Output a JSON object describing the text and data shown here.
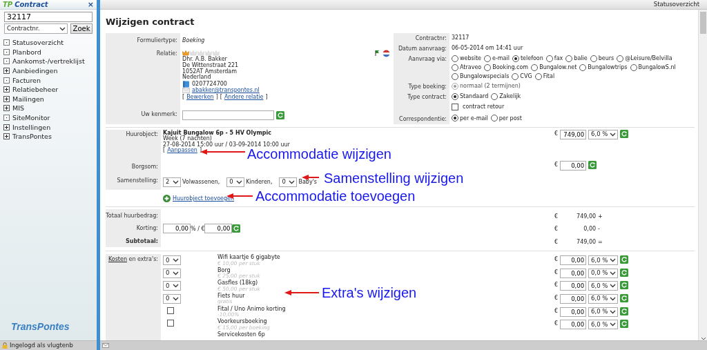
{
  "sidebar": {
    "title_prefix": "TP",
    "title": "Contract",
    "close": "×",
    "search_value": "32117",
    "search_type": "Contractnr.",
    "search_button": "Zoek",
    "items": [
      {
        "label": "Statusoverzicht",
        "kind": "leaf"
      },
      {
        "label": "Planbord",
        "kind": "leaf"
      },
      {
        "label": "Aankomst-/vertreklijst",
        "kind": "leaf"
      },
      {
        "label": "Aanbiedingen",
        "kind": "group",
        "expanded": false
      },
      {
        "label": "Facturen",
        "kind": "leaf"
      },
      {
        "label": "Relatiebeheer",
        "kind": "group",
        "expanded": false
      },
      {
        "label": "Mailingen",
        "kind": "group",
        "expanded": false
      },
      {
        "label": "MIS",
        "kind": "group",
        "expanded": false
      },
      {
        "label": "SiteMonitor",
        "kind": "leaf"
      },
      {
        "label": "Instellingen",
        "kind": "group",
        "expanded": false
      },
      {
        "label": "TransPontes",
        "kind": "group",
        "expanded": false
      }
    ],
    "logo": "TransPontes",
    "login": "Ingelogd als vlugtenb"
  },
  "topbar": {
    "link": "Statusoverzicht"
  },
  "page_title": "Wijzigen contract",
  "relation_card": {
    "formuliertype": {
      "label": "Formuliertype:",
      "value": "Boeking"
    },
    "relatie": {
      "label": "Relatie:",
      "stars": 1,
      "lines": [
        "Dhr. A.B. Bakker",
        "De Wittenstraat 221",
        "1052AT Amsterdam",
        "Nederland"
      ],
      "phone": "0207724700",
      "email": "abakker@transpontes.nl",
      "bracket_open": "[",
      "bracket_close": "]",
      "links": [
        "Bewerken",
        "Andere relatie"
      ]
    },
    "kenmerk": {
      "label": "Uw kenmerk:"
    }
  },
  "contract_card": {
    "rows": [
      {
        "label": "Contractnr:",
        "kind": "text",
        "value": "32117"
      },
      {
        "label": "Datum aanvraag:",
        "kind": "text",
        "value": "06-05-2014 om 14:41 uur"
      },
      {
        "label": "Aanvraag via:",
        "kind": "radios",
        "disabled": false,
        "options": [
          {
            "label": "website",
            "selected": false
          },
          {
            "label": "e-mail",
            "selected": false
          },
          {
            "label": "telefoon",
            "selected": true
          },
          {
            "label": "fax",
            "selected": false
          },
          {
            "label": "balie",
            "selected": false
          },
          {
            "label": "beurs",
            "selected": false
          },
          {
            "label": "@Leisure/Belvilla",
            "selected": false
          },
          {
            "label": "Atraveo",
            "selected": false
          },
          {
            "label": "Booking.com",
            "selected": false
          },
          {
            "label": "Bungalow.net",
            "selected": false
          },
          {
            "label": "Bungalowtrips",
            "selected": false
          },
          {
            "label": "BungalowS.nl",
            "selected": false
          },
          {
            "label": "Bungalowspecials",
            "selected": false
          },
          {
            "label": "CVG",
            "selected": false
          },
          {
            "label": "Fital",
            "selected": false
          }
        ]
      },
      {
        "label": "Type boeking:",
        "kind": "radios",
        "disabled": true,
        "options": [
          {
            "label": "normaal (2 termijnen)",
            "selected": true
          }
        ]
      },
      {
        "label": "Type contract:",
        "kind": "radios",
        "disabled": false,
        "options": [
          {
            "label": "Standaard",
            "selected": true
          },
          {
            "label": "Zakelijk",
            "selected": false
          }
        ]
      },
      {
        "label": "",
        "kind": "checkbox",
        "option": {
          "label": "contract retour",
          "checked": false
        }
      },
      {
        "label": "Correspondentie:",
        "kind": "radios",
        "disabled": false,
        "options": [
          {
            "label": "per e-mail",
            "selected": true
          },
          {
            "label": "per post",
            "selected": false
          }
        ]
      }
    ]
  },
  "rental": {
    "huurobject": {
      "label": "Huurobject:",
      "name": "Kajuit Bungalow 6p - 5 HV Olympic",
      "period": "Week (7 nachten)",
      "dates": "27-08-2014 15:00 uur / 03-09-2014 10:00 uur",
      "bracket_open": "[",
      "bracket_close": "]",
      "link": "Aanpassen",
      "currency": "€",
      "amount": "749,00",
      "vat": "6,0 %"
    },
    "borgsom": {
      "label": "Borgsom:",
      "currency": "€",
      "amount": "0,00"
    },
    "samenstelling": {
      "label": "Samenstelling:",
      "parts": [
        {
          "value": "2",
          "unit": "Volwassenen,"
        },
        {
          "value": "0",
          "unit": "Kinderen,"
        },
        {
          "value": "0",
          "unit": "Baby's"
        }
      ]
    },
    "add_link": "Huurobject toevoegen"
  },
  "totals": [
    {
      "kind": "total",
      "label": "Totaal huurbedrag:",
      "currency": "€",
      "amount": "749,00",
      "sign": "+"
    },
    {
      "kind": "discount",
      "label": "Korting:",
      "percent": "0,00",
      "unit": "% / €",
      "euro": "0,00",
      "currency": "€",
      "amount": "0,00",
      "sign": "-"
    },
    {
      "kind": "subtotal",
      "label": "Subtotaal:",
      "currency": "€",
      "amount": "749,00",
      "sign": "="
    }
  ],
  "extras": {
    "label_link": "Kosten",
    "label_rest": "en extra's:",
    "items": [
      {
        "kind": "select",
        "qty": "0",
        "name": "Wifi kaartje 6 gigabyte",
        "price": "€ 10,00 per stuk",
        "currency": "€",
        "amount": "0,00",
        "vat": "6,0 %"
      },
      {
        "kind": "select",
        "qty": "0",
        "name": "Borg",
        "price": "€ 25,00 per stuk",
        "currency": "€",
        "amount": "0,00",
        "vat": "0,0 %"
      },
      {
        "kind": "select",
        "qty": "0",
        "name": "Gasfles (18kg)",
        "price": "€ 50,00 per stuk",
        "currency": "€",
        "amount": "0,00",
        "vat": "6,0 %"
      },
      {
        "kind": "select",
        "qty": "0",
        "name": "Fiets huur",
        "price": "gratis",
        "currency": "€",
        "amount": "0,00",
        "vat": "6,0 %"
      },
      {
        "kind": "checkbox",
        "checked": false,
        "name": "Fital / Uno Animo korting",
        "price": "-10,00%",
        "currency": "€",
        "amount": "0,00",
        "vat": "6,0 %"
      },
      {
        "kind": "checkbox",
        "checked": false,
        "name": "Voorkeursboeking",
        "price": "€ 15,00 per boeking",
        "currency": "€",
        "amount": "0,00",
        "vat": "6,0 %"
      },
      {
        "kind": "partial",
        "name": "Servicekosten 6p"
      }
    ]
  },
  "annotations": [
    {
      "text": "Accommodatie wijzigen"
    },
    {
      "text": "Samenstelling wijzigen"
    },
    {
      "text": "Accommodatie toevoegen"
    },
    {
      "text": "Extra's wijzigen"
    }
  ]
}
